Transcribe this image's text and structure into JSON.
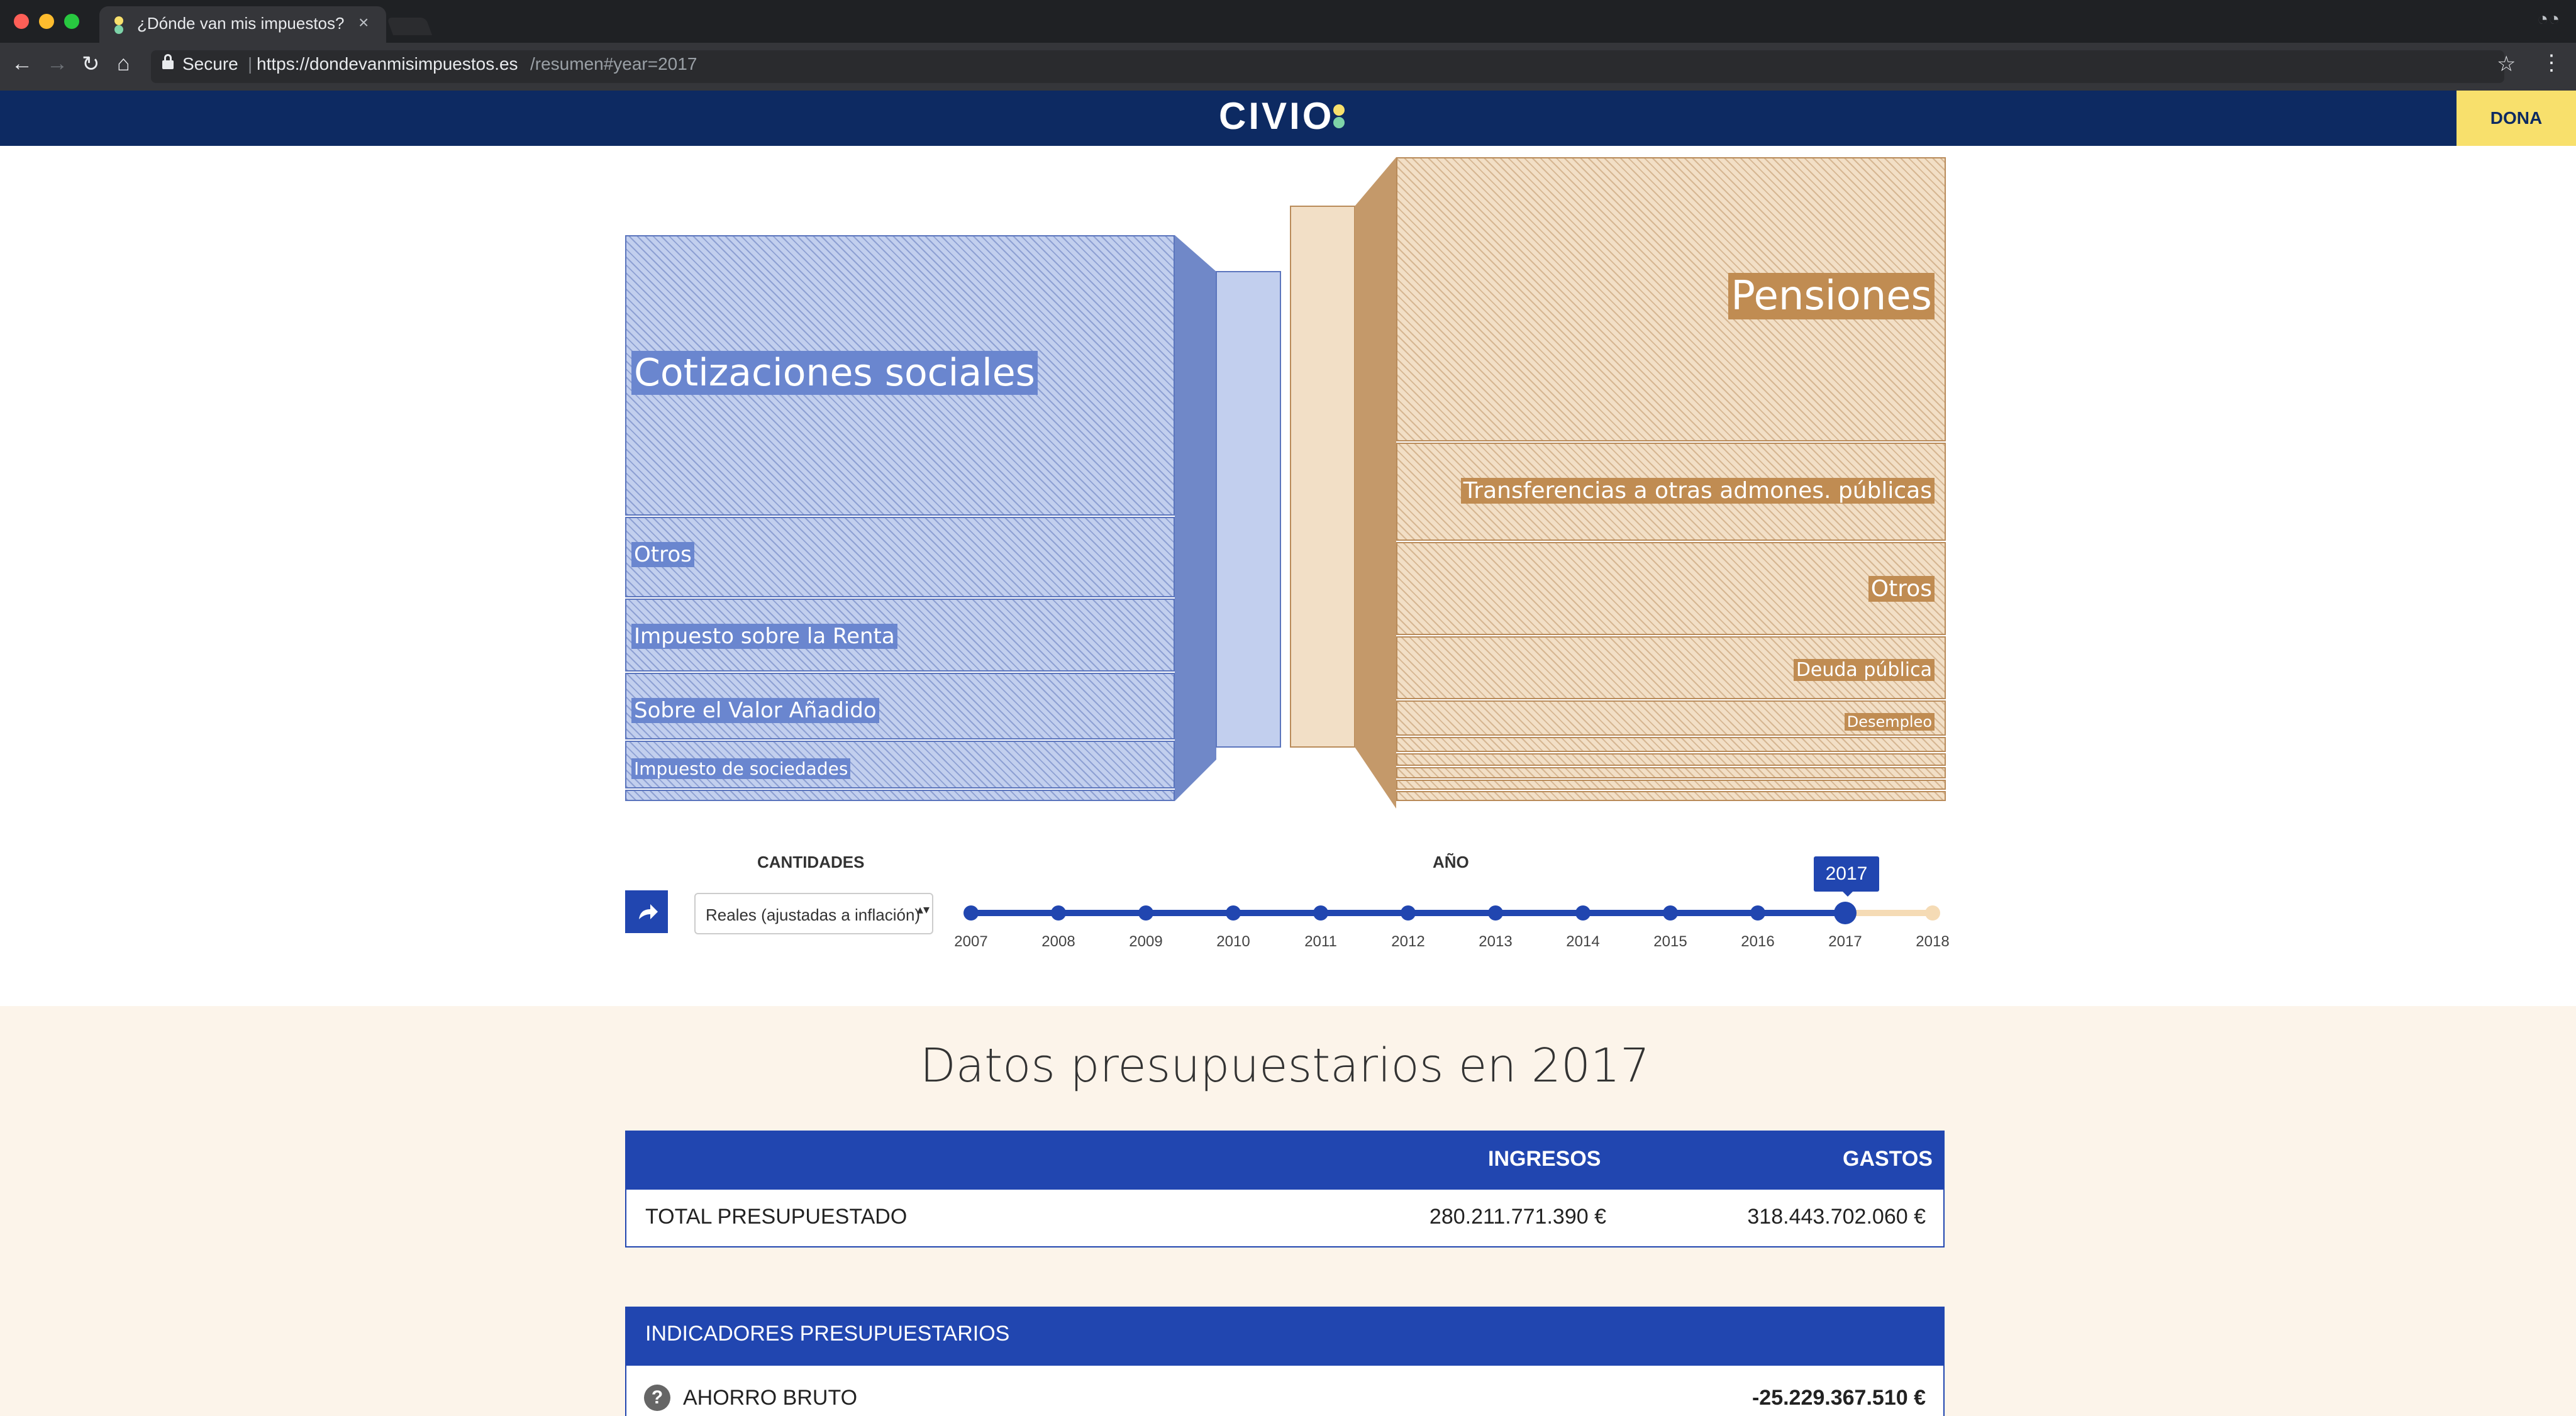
{
  "browser": {
    "tab_title": "¿Dónde van mis impuestos?",
    "tab_close": "×",
    "secure_label": "Secure",
    "url_separator": "|",
    "url_host": "https://dondevanmisimpuestos.es",
    "url_path": "/resumen#year=2017",
    "back_icon": "←",
    "forward_icon": "→",
    "reload_icon": "↻",
    "home_icon": "⌂",
    "star_icon": "☆",
    "menu_icon": "⋮",
    "incognito_icon": "◔◔",
    "traffic_lights": [
      "#fe5f57",
      "#febc2e",
      "#28c840"
    ]
  },
  "site": {
    "logo_text": "CIVIO",
    "logo_dot_colors": [
      "#f8e06c",
      "#7dd3a8"
    ],
    "donate_label": "DONA",
    "brand_color": "#0d2a62",
    "accent_blue": "#2146b0"
  },
  "viz": {
    "income": [
      {
        "label": "Cotizaciones sociales"
      },
      {
        "label": "Otros"
      },
      {
        "label": "Impuesto sobre la Renta"
      },
      {
        "label": "Sobre el Valor Añadido"
      },
      {
        "label": "Impuesto de sociedades"
      }
    ],
    "expenses": [
      {
        "label": "Pensiones"
      },
      {
        "label": "Transferencias a otras admones. públicas"
      },
      {
        "label": "Otros"
      },
      {
        "label": "Deuda pública"
      },
      {
        "label": "Desempleo"
      }
    ]
  },
  "controls": {
    "amounts_heading": "CANTIDADES",
    "amounts_value": "Reales (ajustadas a inflación)",
    "select_arrows": "▴▾",
    "year_heading": "AÑO",
    "selected_year": "2017",
    "share_icon": "share-arrow-icon",
    "years": [
      "2007",
      "2008",
      "2009",
      "2010",
      "2011",
      "2012",
      "2013",
      "2014",
      "2015",
      "2016",
      "2017",
      "2018"
    ]
  },
  "budget": {
    "title": "Datos presupuestarios en 2017",
    "income_header": "INGRESOS",
    "expenses_header": "GASTOS",
    "total_label": "TOTAL PRESUPUESTADO",
    "total_income": "280.211.771.390 €",
    "total_expenses": "318.443.702.060 €",
    "indicators_header": "INDICADORES PRESUPUESTARIOS",
    "help_icon": "?",
    "gross_savings_label": "AHORRO BRUTO",
    "gross_savings_value": "-25.229.367.510 €"
  }
}
